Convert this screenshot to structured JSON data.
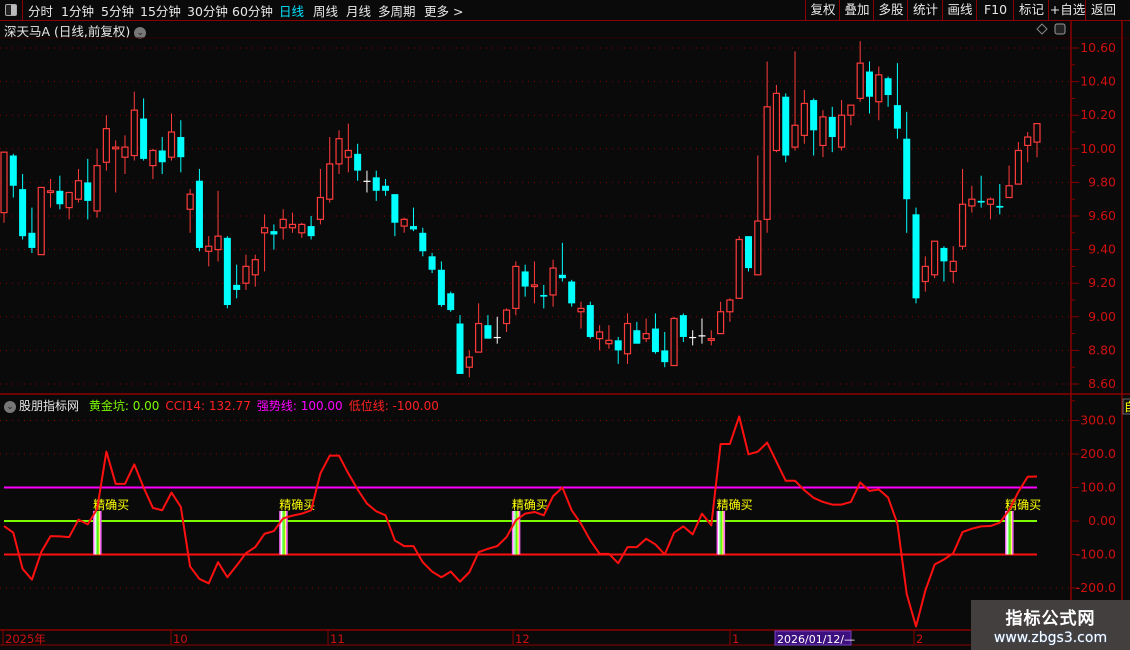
{
  "toolbar": {
    "periods": [
      {
        "label": "分时",
        "active": false
      },
      {
        "label": "1分钟",
        "active": false
      },
      {
        "label": "5分钟",
        "active": false
      },
      {
        "label": "15分钟",
        "active": false
      },
      {
        "label": "30分钟",
        "active": false
      },
      {
        "label": "60分钟",
        "active": false
      },
      {
        "label": "日线",
        "active": true
      },
      {
        "label": "周线",
        "active": false
      },
      {
        "label": "月线",
        "active": false
      },
      {
        "label": "多周期",
        "active": false
      },
      {
        "label": "更多 >",
        "active": false
      }
    ],
    "buttons": [
      "复权",
      "叠加",
      "多股",
      "统计",
      "画线",
      "F10",
      "标记",
      "+自选",
      "返回"
    ]
  },
  "main": {
    "stock_title": "深天马A (日线,前复权)",
    "price_axis": [
      "10.60",
      "10.40",
      "10.20",
      "10.00",
      "9.80",
      "9.60",
      "9.40",
      "9.20",
      "9.00",
      "8.80",
      "8.60"
    ]
  },
  "indicator": {
    "name": "股朋指标网",
    "legend": [
      {
        "label": "黄金坑: 0.00",
        "color": "#7cfc00"
      },
      {
        "label": "CCI14: 132.77",
        "color": "#ff2020"
      },
      {
        "label": "强势线: 100.00",
        "color": "#ff00ff"
      },
      {
        "label": "低位线: -100.00",
        "color": "#ff2020"
      }
    ],
    "axis": [
      "300.0",
      "200.0",
      "100.0",
      "0.00",
      "-100.0",
      "-200.0"
    ],
    "signal_label": "精确买",
    "right_tag": "自"
  },
  "x_axis": {
    "labels": [
      "2025年",
      "10",
      "11",
      "12",
      "1",
      "2"
    ],
    "cursor_date": "2026/01/12/—"
  },
  "watermark": {
    "title": "指标公式网",
    "url": "www.zbgs3.com"
  },
  "colors": {
    "up": "#ff3b3b",
    "down": "#00ffff",
    "flat": "#ffffff",
    "strong_line": "#ff00ff",
    "zero_line": "#7cfc00",
    "low_line": "#ff1010",
    "cci": "#ff1010",
    "grid": "#8b0000",
    "signal_text": "#ffff00"
  },
  "chart_data": [
    {
      "type": "candlestick",
      "ylim": [
        8.6,
        10.6
      ],
      "ohlc": [
        [
          9.62,
          9.98,
          9.56,
          9.98
        ],
        [
          9.96,
          9.97,
          9.71,
          9.78
        ],
        [
          9.76,
          9.85,
          9.46,
          9.48
        ],
        [
          9.5,
          9.65,
          9.38,
          9.41
        ],
        [
          9.37,
          9.77,
          9.37,
          9.77
        ],
        [
          9.74,
          9.82,
          9.65,
          9.75
        ],
        [
          9.75,
          9.84,
          9.64,
          9.67
        ],
        [
          9.65,
          9.74,
          9.58,
          9.74
        ],
        [
          9.7,
          9.88,
          9.68,
          9.81
        ],
        [
          9.8,
          9.94,
          9.58,
          9.69
        ],
        [
          9.63,
          10.0,
          9.59,
          9.9
        ],
        [
          9.92,
          10.2,
          9.87,
          10.12
        ],
        [
          10.0,
          10.05,
          9.74,
          10.01
        ],
        [
          9.95,
          10.08,
          9.85,
          10.01
        ],
        [
          9.96,
          10.34,
          9.93,
          10.23
        ],
        [
          10.18,
          10.3,
          9.93,
          9.94
        ],
        [
          9.9,
          10.0,
          9.82,
          9.99
        ],
        [
          9.99,
          10.07,
          9.85,
          9.92
        ],
        [
          9.95,
          10.21,
          9.93,
          10.1
        ],
        [
          10.07,
          10.17,
          9.86,
          9.95
        ],
        [
          9.64,
          9.76,
          9.5,
          9.73
        ],
        [
          9.81,
          9.88,
          9.39,
          9.41
        ],
        [
          9.39,
          9.48,
          9.3,
          9.42
        ],
        [
          9.4,
          9.75,
          9.33,
          9.48
        ],
        [
          9.47,
          9.48,
          9.05,
          9.07
        ],
        [
          9.19,
          9.31,
          9.11,
          9.16
        ],
        [
          9.2,
          9.37,
          9.16,
          9.3
        ],
        [
          9.25,
          9.37,
          9.18,
          9.34
        ],
        [
          9.5,
          9.61,
          9.27,
          9.53
        ],
        [
          9.51,
          9.55,
          9.4,
          9.49
        ],
        [
          9.53,
          9.64,
          9.46,
          9.58
        ],
        [
          9.53,
          9.62,
          9.5,
          9.55
        ],
        [
          9.5,
          9.56,
          9.47,
          9.55
        ],
        [
          9.54,
          9.6,
          9.46,
          9.48
        ],
        [
          9.58,
          9.88,
          9.55,
          9.71
        ],
        [
          9.7,
          10.07,
          9.68,
          9.91
        ],
        [
          9.91,
          10.11,
          9.85,
          10.06
        ],
        [
          9.95,
          10.15,
          9.86,
          9.99
        ],
        [
          9.97,
          10.03,
          9.81,
          9.87
        ],
        [
          9.81,
          9.87,
          9.74,
          9.81
        ],
        [
          9.83,
          9.87,
          9.69,
          9.75
        ],
        [
          9.78,
          9.82,
          9.72,
          9.75
        ],
        [
          9.73,
          9.73,
          9.48,
          9.56
        ],
        [
          9.54,
          9.59,
          9.5,
          9.58
        ],
        [
          9.54,
          9.65,
          9.51,
          9.52
        ],
        [
          9.5,
          9.53,
          9.36,
          9.39
        ],
        [
          9.36,
          9.38,
          9.26,
          9.28
        ],
        [
          9.28,
          9.33,
          9.06,
          9.07
        ],
        [
          9.14,
          9.15,
          9.03,
          9.04
        ],
        [
          8.96,
          9.01,
          8.66,
          8.66
        ],
        [
          8.7,
          8.8,
          8.64,
          8.76
        ],
        [
          8.79,
          9.08,
          8.79,
          8.96
        ],
        [
          8.95,
          9.01,
          8.87,
          8.87
        ],
        [
          8.88,
          9.0,
          8.84,
          8.88
        ],
        [
          8.96,
          9.05,
          8.91,
          9.04
        ],
        [
          9.05,
          9.33,
          9.01,
          9.3
        ],
        [
          9.27,
          9.31,
          9.12,
          9.18
        ],
        [
          9.18,
          9.33,
          9.08,
          9.19
        ],
        [
          9.13,
          9.19,
          9.05,
          9.12
        ],
        [
          9.13,
          9.34,
          9.06,
          9.29
        ],
        [
          9.25,
          9.44,
          9.21,
          9.23
        ],
        [
          9.21,
          9.22,
          9.06,
          9.08
        ],
        [
          9.03,
          9.09,
          8.93,
          9.05
        ],
        [
          9.07,
          9.09,
          8.87,
          8.88
        ],
        [
          8.87,
          8.95,
          8.8,
          8.91
        ],
        [
          8.84,
          8.95,
          8.81,
          8.86
        ],
        [
          8.86,
          8.88,
          8.72,
          8.8
        ],
        [
          8.78,
          9.02,
          8.72,
          8.96
        ],
        [
          8.92,
          8.97,
          8.84,
          8.84
        ],
        [
          8.87,
          8.99,
          8.85,
          8.9
        ],
        [
          8.93,
          9.02,
          8.78,
          8.79
        ],
        [
          8.8,
          8.91,
          8.7,
          8.73
        ],
        [
          8.71,
          9.0,
          8.71,
          8.99
        ],
        [
          9.01,
          9.02,
          8.85,
          8.88
        ],
        [
          8.88,
          8.92,
          8.83,
          8.88
        ],
        [
          8.89,
          8.99,
          8.84,
          8.89
        ],
        [
          8.86,
          8.92,
          8.83,
          8.87
        ],
        [
          8.9,
          9.09,
          8.9,
          9.03
        ],
        [
          9.03,
          9.11,
          8.97,
          9.1
        ],
        [
          9.11,
          9.48,
          9.11,
          9.46
        ],
        [
          9.48,
          9.48,
          9.27,
          9.29
        ],
        [
          9.25,
          9.96,
          9.25,
          9.57
        ],
        [
          9.58,
          10.52,
          9.5,
          10.25
        ],
        [
          9.99,
          10.38,
          9.98,
          10.33
        ],
        [
          10.31,
          10.33,
          9.92,
          9.96
        ],
        [
          10.01,
          10.58,
          9.99,
          10.14
        ],
        [
          10.08,
          10.35,
          10.03,
          10.27
        ],
        [
          10.29,
          10.3,
          9.96,
          10.11
        ],
        [
          10.02,
          10.23,
          9.95,
          10.19
        ],
        [
          10.19,
          10.25,
          9.98,
          10.07
        ],
        [
          10.01,
          10.29,
          9.99,
          10.2
        ],
        [
          10.2,
          10.26,
          10.14,
          10.26
        ],
        [
          10.3,
          10.64,
          10.28,
          10.51
        ],
        [
          10.46,
          10.52,
          10.21,
          10.31
        ],
        [
          10.28,
          10.49,
          10.17,
          10.44
        ],
        [
          10.42,
          10.43,
          10.25,
          10.32
        ],
        [
          10.26,
          10.51,
          10.06,
          10.12
        ],
        [
          10.06,
          10.22,
          9.5,
          9.7
        ],
        [
          9.61,
          9.65,
          9.08,
          9.11
        ],
        [
          9.21,
          9.36,
          9.15,
          9.3
        ],
        [
          9.25,
          9.45,
          9.23,
          9.45
        ],
        [
          9.41,
          9.42,
          9.21,
          9.33
        ],
        [
          9.27,
          9.42,
          9.2,
          9.33
        ],
        [
          9.42,
          9.88,
          9.4,
          9.67
        ],
        [
          9.66,
          9.78,
          9.62,
          9.7
        ],
        [
          9.69,
          9.84,
          9.65,
          9.68
        ],
        [
          9.67,
          9.71,
          9.58,
          9.7
        ],
        [
          9.66,
          9.79,
          9.61,
          9.65
        ],
        [
          9.71,
          9.9,
          9.71,
          9.78
        ],
        [
          9.79,
          10.04,
          9.79,
          9.99
        ],
        [
          10.02,
          10.1,
          9.92,
          10.07
        ],
        [
          10.04,
          10.15,
          9.95,
          10.15
        ]
      ]
    },
    {
      "type": "line",
      "ylim": [
        -320,
        320
      ],
      "series": [
        {
          "name": "CCI14",
          "values": [
            -15,
            -35,
            -143,
            -175,
            -93,
            -45,
            -46,
            -48,
            4,
            -10,
            35,
            207,
            111,
            111,
            169,
            100,
            39,
            32,
            85,
            42,
            -136,
            -173,
            -186,
            -123,
            -168,
            -133,
            -96,
            -78,
            -38,
            -30,
            8,
            16,
            22,
            32,
            142,
            195,
            195,
            142,
            94,
            52,
            29,
            17,
            -58,
            -75,
            -75,
            -123,
            -151,
            -168,
            -151,
            -181,
            -153,
            -93,
            -83,
            -75,
            -48,
            2,
            22,
            27,
            17,
            74,
            100,
            32,
            -8,
            -58,
            -98,
            -98,
            -126,
            -78,
            -78,
            -53,
            -70,
            -100,
            -35,
            -16,
            -40,
            22,
            -13,
            230,
            230,
            312,
            199,
            207,
            234,
            177,
            120,
            120,
            92,
            69,
            57,
            49,
            49,
            57,
            115,
            90,
            94,
            70,
            -8,
            -218,
            -315,
            -208,
            -130,
            -115,
            -96,
            -33,
            -23,
            -16,
            -15,
            -5,
            32,
            87,
            132,
            132.77
          ]
        },
        {
          "name": "强势线",
          "value": 100
        },
        {
          "name": "黄金坑",
          "value": 0
        },
        {
          "name": "低位线",
          "value": -100
        }
      ],
      "signals": [
        10,
        30,
        55,
        77,
        108
      ]
    }
  ]
}
